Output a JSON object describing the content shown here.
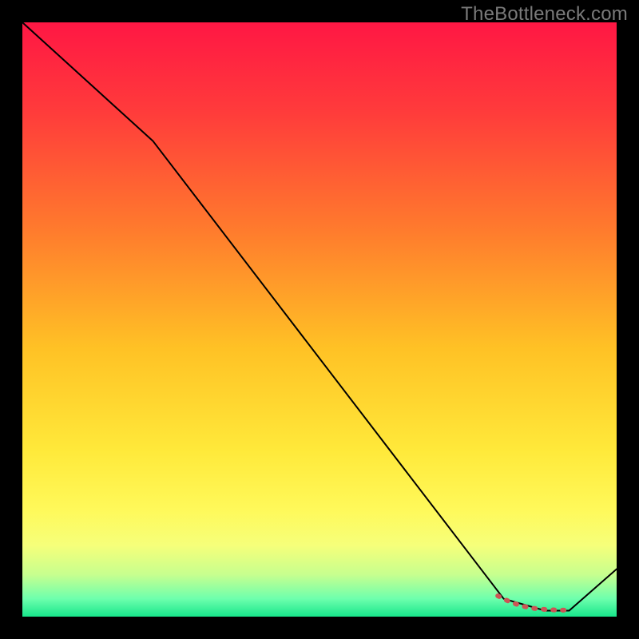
{
  "watermark": "TheBottleneck.com",
  "chart_data": {
    "type": "line",
    "title": "",
    "xlabel": "",
    "ylabel": "",
    "xlim": [
      0,
      100
    ],
    "ylim": [
      0,
      100
    ],
    "grid": false,
    "series": [
      {
        "name": "bottleneck-curve",
        "type": "line",
        "color": "#000000",
        "stroke_width": 2,
        "x": [
          0,
          22,
          81,
          88,
          92,
          100
        ],
        "values": [
          100,
          80,
          3,
          1,
          1,
          8
        ]
      },
      {
        "name": "optimal-band-marker",
        "type": "line",
        "color": "#cc5555",
        "stroke_width": 6,
        "dashed": true,
        "x": [
          80,
          82,
          84,
          86,
          88,
          90,
          92
        ],
        "values": [
          3.5,
          2.5,
          1.8,
          1.4,
          1.2,
          1.1,
          1.1
        ]
      }
    ],
    "background_gradient": {
      "stops": [
        {
          "offset": 0.0,
          "color": "#ff1744"
        },
        {
          "offset": 0.15,
          "color": "#ff3b3b"
        },
        {
          "offset": 0.35,
          "color": "#ff7b2d"
        },
        {
          "offset": 0.55,
          "color": "#ffc225"
        },
        {
          "offset": 0.72,
          "color": "#ffe93a"
        },
        {
          "offset": 0.82,
          "color": "#fff95a"
        },
        {
          "offset": 0.88,
          "color": "#f6ff7a"
        },
        {
          "offset": 0.93,
          "color": "#c6ff8f"
        },
        {
          "offset": 0.97,
          "color": "#6dffad"
        },
        {
          "offset": 1.0,
          "color": "#17e68b"
        }
      ]
    }
  }
}
